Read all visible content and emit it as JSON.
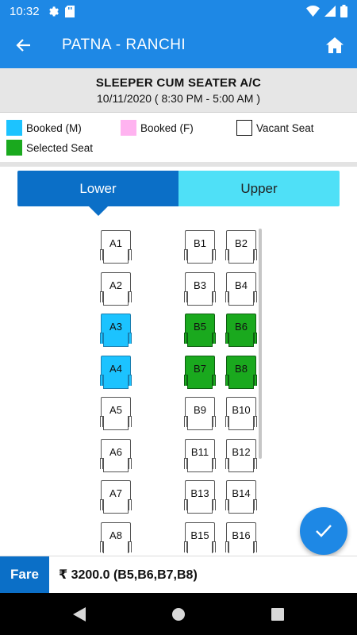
{
  "status": {
    "time": "10:32"
  },
  "header": {
    "title": "PATNA - RANCHI"
  },
  "bus": {
    "type": "SLEEPER CUM SEATER A/C",
    "date": "10/11/2020   ( 8:30 PM - 5:00 AM )"
  },
  "legend": [
    {
      "label": "Booked (M)",
      "color": "#1cc3ff"
    },
    {
      "label": "Booked (F)",
      "color": "#ffb3f0"
    },
    {
      "label": "Vacant Seat",
      "color": "#ffffff"
    },
    {
      "label": "Selected Seat",
      "color": "#1aa91e"
    }
  ],
  "tabs": {
    "lower": "Lower",
    "upper": "Upper"
  },
  "seats": {
    "A": [
      {
        "label": "A1",
        "status": "vacant"
      },
      {
        "label": "A2",
        "status": "vacant"
      },
      {
        "label": "A3",
        "status": "booked-m"
      },
      {
        "label": "A4",
        "status": "booked-m"
      },
      {
        "label": "A5",
        "status": "vacant"
      },
      {
        "label": "A6",
        "status": "vacant"
      },
      {
        "label": "A7",
        "status": "vacant"
      },
      {
        "label": "A8",
        "status": "vacant"
      }
    ],
    "B": [
      {
        "label": "B1",
        "status": "vacant"
      },
      {
        "label": "B2",
        "status": "vacant"
      },
      {
        "label": "B3",
        "status": "vacant"
      },
      {
        "label": "B4",
        "status": "vacant"
      },
      {
        "label": "B5",
        "status": "selected"
      },
      {
        "label": "B6",
        "status": "selected"
      },
      {
        "label": "B7",
        "status": "selected"
      },
      {
        "label": "B8",
        "status": "selected"
      },
      {
        "label": "B9",
        "status": "vacant"
      },
      {
        "label": "B10",
        "status": "vacant"
      },
      {
        "label": "B11",
        "status": "vacant"
      },
      {
        "label": "B12",
        "status": "vacant"
      },
      {
        "label": "B13",
        "status": "vacant"
      },
      {
        "label": "B14",
        "status": "vacant"
      },
      {
        "label": "B15",
        "status": "vacant"
      },
      {
        "label": "B16",
        "status": "vacant"
      }
    ]
  },
  "fare": {
    "label": "Fare",
    "value": "₹ 3200.0 (B5,B6,B7,B8)"
  },
  "icons": {
    "back": "arrow-left-icon",
    "home": "home-icon",
    "confirm": "check-icon"
  },
  "colors": {
    "primary": "#1e88e5",
    "tab_active": "#0b6fc7",
    "tab_inactive": "#4fe0f7"
  }
}
